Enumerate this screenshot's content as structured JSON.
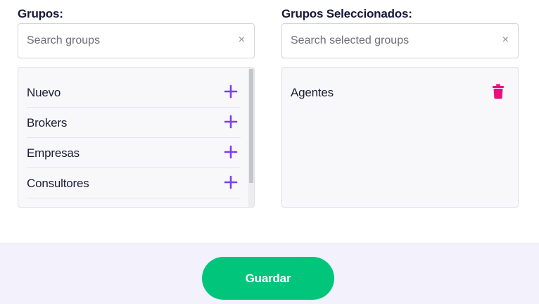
{
  "left": {
    "title": "Grupos:",
    "search_placeholder": "Search groups",
    "clear_glyph": "×",
    "items": [
      {
        "label": "Nuevo",
        "icon": "plus-icon"
      },
      {
        "label": "Brokers",
        "icon": "plus-icon"
      },
      {
        "label": "Empresas",
        "icon": "plus-icon"
      },
      {
        "label": "Consultores",
        "icon": "plus-icon"
      }
    ]
  },
  "right": {
    "title": "Grupos Seleccionados:",
    "search_placeholder": "Search selected groups",
    "clear_glyph": "×",
    "items": [
      {
        "label": "Agentes",
        "icon": "trash-icon"
      }
    ]
  },
  "footer": {
    "save_label": "Guardar"
  },
  "colors": {
    "accent_purple": "#7b3ff2",
    "delete_pink": "#e5127d",
    "save_green": "#02c57c",
    "title_navy": "#16173a",
    "footer_bg": "#f3f1fb"
  }
}
